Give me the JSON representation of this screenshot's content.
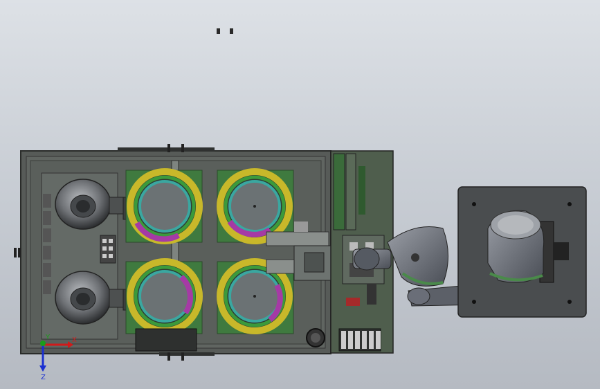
{
  "viewport": {
    "background_top": "#dde1e6",
    "background_bottom": "#b5bac2"
  },
  "triad": {
    "x_label": "X",
    "y_label": "Y",
    "z_label": "Z",
    "x_color": "#d11a1a",
    "y_color": "#1a9e1a",
    "z_color": "#1a2fd1"
  },
  "model": {
    "frame_color": "#5a5e5a",
    "panel_color": "#4d5a4d",
    "tray_color": "#3f7a3f",
    "yellow_ring": "#c8b82a",
    "green_ring": "#3b9a3b",
    "teal_ring": "#3aa7a0",
    "magenta_ring": "#a53aa5",
    "robot_color": "#6a6e78",
    "robot_band": "#4a8a4a",
    "icons": [
      "vibratory-bowl",
      "rotary-feeder",
      "robot-arm",
      "robot-base-plate"
    ]
  }
}
